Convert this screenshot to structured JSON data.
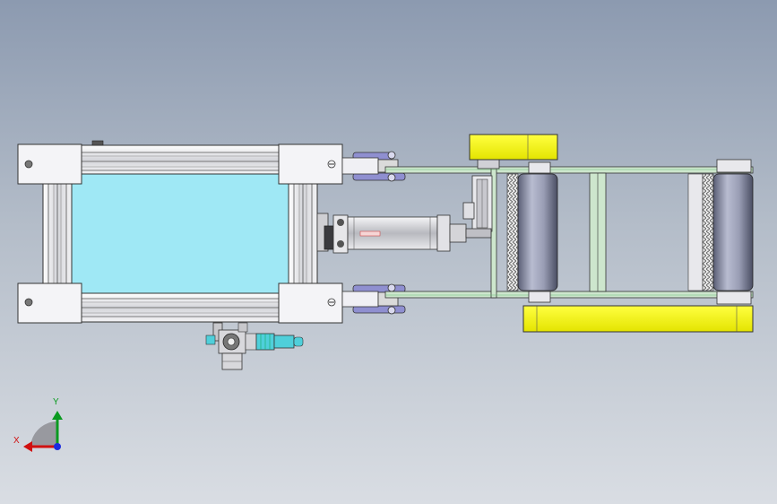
{
  "viewport": {
    "background_top": "#8c9ab0",
    "background_bottom": "#d9dde3"
  },
  "triad": {
    "x_label": "X",
    "y_label": "Y",
    "x_color": "#d01010",
    "y_color": "#0a9a20",
    "z_color": "#1a2adf"
  },
  "colors": {
    "glass": "#9fe8f5",
    "corner_block": "#f4f4f7",
    "extrusion": "#e6e7ea",
    "frame_rail": "#cde6cd",
    "yellow_cover": "#ffff20",
    "roller": "#8f93a8",
    "linkage": "#8f8fd0",
    "cylinder": "#d6d6d9",
    "valve": "#4fcfda"
  }
}
